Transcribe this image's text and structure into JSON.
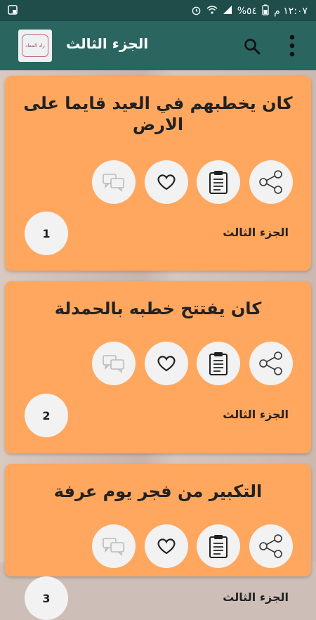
{
  "statusbar": {
    "time": "١٢:٠٧ م",
    "battery": "%٥٤"
  },
  "appbar": {
    "title": "الجزء الثالث",
    "logo_text": "زاد المعاد"
  },
  "cards": [
    {
      "title": "كان يخطبهم في العيد قايما على الارض",
      "part": "الجزء الثالث",
      "number": "1"
    },
    {
      "title": "كان يفتتح خطبه بالحمدلة",
      "part": "الجزء الثالث",
      "number": "2"
    },
    {
      "title": "التكبير من فجر يوم عرفة",
      "part": "الجزء الثالث",
      "number": "3"
    }
  ],
  "colors": {
    "appbar": "#2a6560",
    "statusbar": "#1e4d4a",
    "card": "#ffa75f"
  }
}
